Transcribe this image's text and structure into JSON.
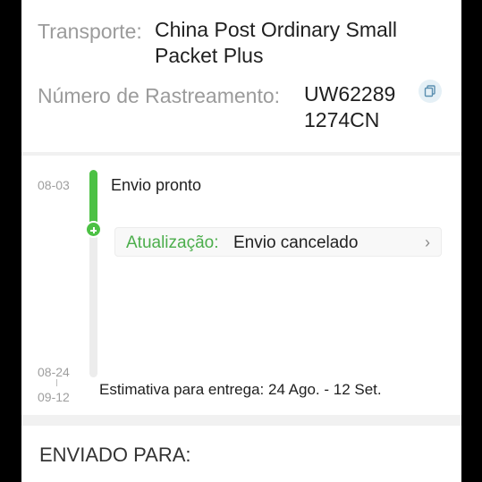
{
  "shipping": {
    "carrier_label": "Transporte:",
    "carrier_line1": "China Post Ordinary Small",
    "carrier_line2": "Packet Plus",
    "tracking_label": "Número de Rastreamento:",
    "tracking_line1": "UW62289",
    "tracking_line2": "1274CN",
    "copy_icon": "copy-icon"
  },
  "timeline": {
    "events": [
      {
        "date": "08-03",
        "text": "Envio pronto"
      }
    ],
    "update": {
      "label": "Atualização:",
      "value": "Envio cancelado",
      "chevron": "›"
    },
    "estimate": {
      "date_from": "08-24",
      "date_to": "09-12",
      "text": "Estimativa para entrega: 24 Ago. - 12 Set."
    },
    "colors": {
      "progress": "#4cc144",
      "update_label": "#4cae4c"
    }
  },
  "shipped_to": {
    "heading": "ENVIADO PARA:"
  }
}
